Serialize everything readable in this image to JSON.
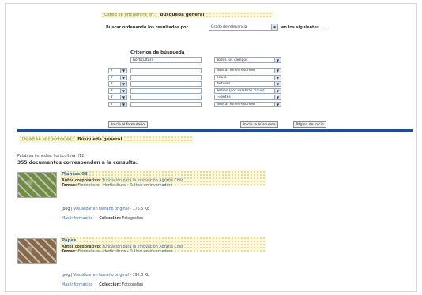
{
  "breadcrumb": {
    "prefix": "Usted se encuentra en:",
    "current": "Búsqueda general"
  },
  "sort": {
    "label": "Buscar ordenando los resultados por",
    "option": "Grado de relevancia",
    "suffix": "en los siguientes..."
  },
  "criteria": {
    "title": "Criterios de búsqueda",
    "term": "horticultura",
    "field": "Todos los campos",
    "rows": [
      {
        "op": "Y",
        "field": "Buscar en el resumen"
      },
      {
        "op": "Y",
        "field": "Título"
      },
      {
        "op": "Y",
        "field": "Autores"
      },
      {
        "op": "Y",
        "field": "Temas (por Palabras clave)"
      },
      {
        "op": "Y",
        "field": "Fuentes"
      },
      {
        "op": "Y",
        "field": "Buscar en el resumen"
      }
    ]
  },
  "buttons": {
    "reset": "Inicie el formulario",
    "search": "Inicie la búsqueda",
    "home": "Página de inicio"
  },
  "results": {
    "keywords": "Palabras inmédas: horticultura ·f12",
    "count": "355 documentos corresponden a la consulta.",
    "items": [
      {
        "title": "Plantas 03",
        "author_label": "Autor corporativo:",
        "author": "Fundación para la Innovación Agraria Chile",
        "topics_label": "Temas:",
        "topics": [
          "Floricultura",
          "Horticultura",
          "Cultivo en invernadero"
        ],
        "format": "jpeg",
        "view_link": "Visualizar en tamaño original",
        "size": "175.5 Kb",
        "more": "Más información",
        "collection_label": "Colección:",
        "collection": "Fotografías",
        "thumb_color": "#6f8f3e"
      },
      {
        "title": "Papas",
        "author_label": "Autor corporativo:",
        "author": "Fundación para la Innovación Agraria Chile",
        "topics_label": "Temas:",
        "topics": [
          "Floricultura",
          "Horticultura",
          "Cultivo en invernadero"
        ],
        "format": "jpeg",
        "view_link": "Visualizar en tamaño original",
        "size": "192.0 Kb",
        "more": "Más información",
        "collection_label": "Colección:",
        "collection": "Fotografías",
        "thumb_color": "#8a6a44"
      }
    ]
  },
  "colors": {
    "divider": "#1f4f8f",
    "link": "#3c6bb0",
    "crumb": "#5f8f3a",
    "highlight": "#fbf7de"
  }
}
